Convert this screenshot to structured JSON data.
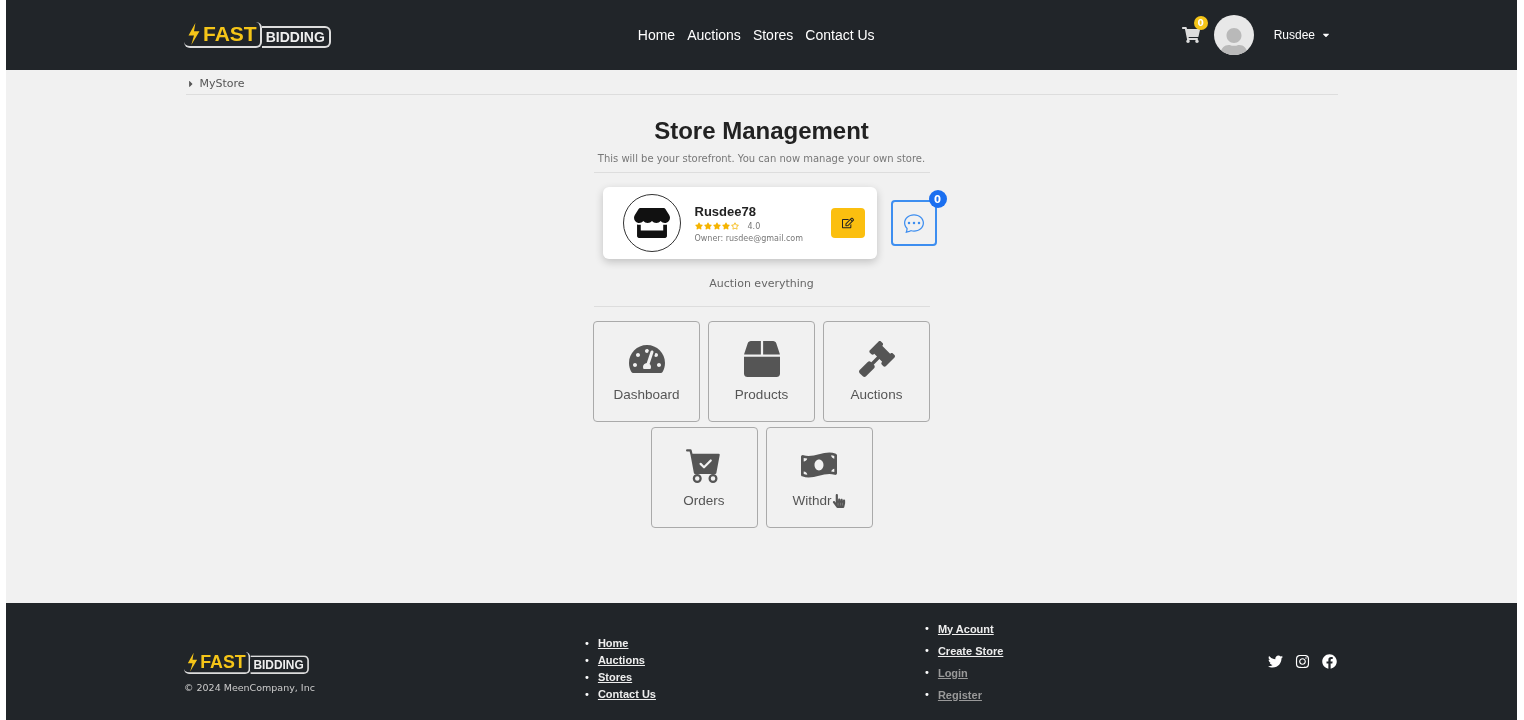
{
  "header": {
    "logo": {
      "fast": "FAST",
      "bidding": "BIDDING"
    },
    "nav": [
      {
        "label": "Home"
      },
      {
        "label": "Auctions"
      },
      {
        "label": "Stores"
      },
      {
        "label": "Contact Us"
      }
    ],
    "cart_count": "0",
    "user": "Rusdee"
  },
  "breadcrumb": "MyStore",
  "title": "Store Management",
  "subtitle": "This will be your storefront. You can now manage your own store.",
  "store": {
    "name": "Rusdee78",
    "stars": 4,
    "rating": "4.0",
    "owner": "Owner: rusdee@gmail.com",
    "chat_count": "0",
    "description": "Auction everything"
  },
  "tiles": [
    {
      "kind": "dashboard",
      "label": "Dashboard"
    },
    {
      "kind": "products",
      "label": "Products"
    },
    {
      "kind": "auctions",
      "label": "Auctions"
    },
    {
      "kind": "orders",
      "label": "Orders"
    },
    {
      "kind": "withdraw",
      "label": "Withdr"
    }
  ],
  "footer": {
    "logo": {
      "fast": "FAST",
      "bidding": "BIDDING"
    },
    "copyright": "© 2024 MeenCompany, Inc",
    "links_1": [
      {
        "bullet": "•",
        "label": "Home",
        "disabled": false
      },
      {
        "bullet": "•",
        "label": "Auctions",
        "disabled": false
      },
      {
        "bullet": "•",
        "label": "Stores",
        "disabled": false
      },
      {
        "bullet": "•",
        "label": "Contact Us",
        "disabled": false
      }
    ],
    "links_2": [
      {
        "bullet": "•",
        "label": "My Acount",
        "disabled": false
      },
      {
        "bullet": "•",
        "label": "Create Store",
        "disabled": false
      },
      {
        "bullet": "•",
        "label": "Login",
        "disabled": true
      },
      {
        "bullet": "•",
        "label": "Register",
        "disabled": true
      }
    ]
  }
}
